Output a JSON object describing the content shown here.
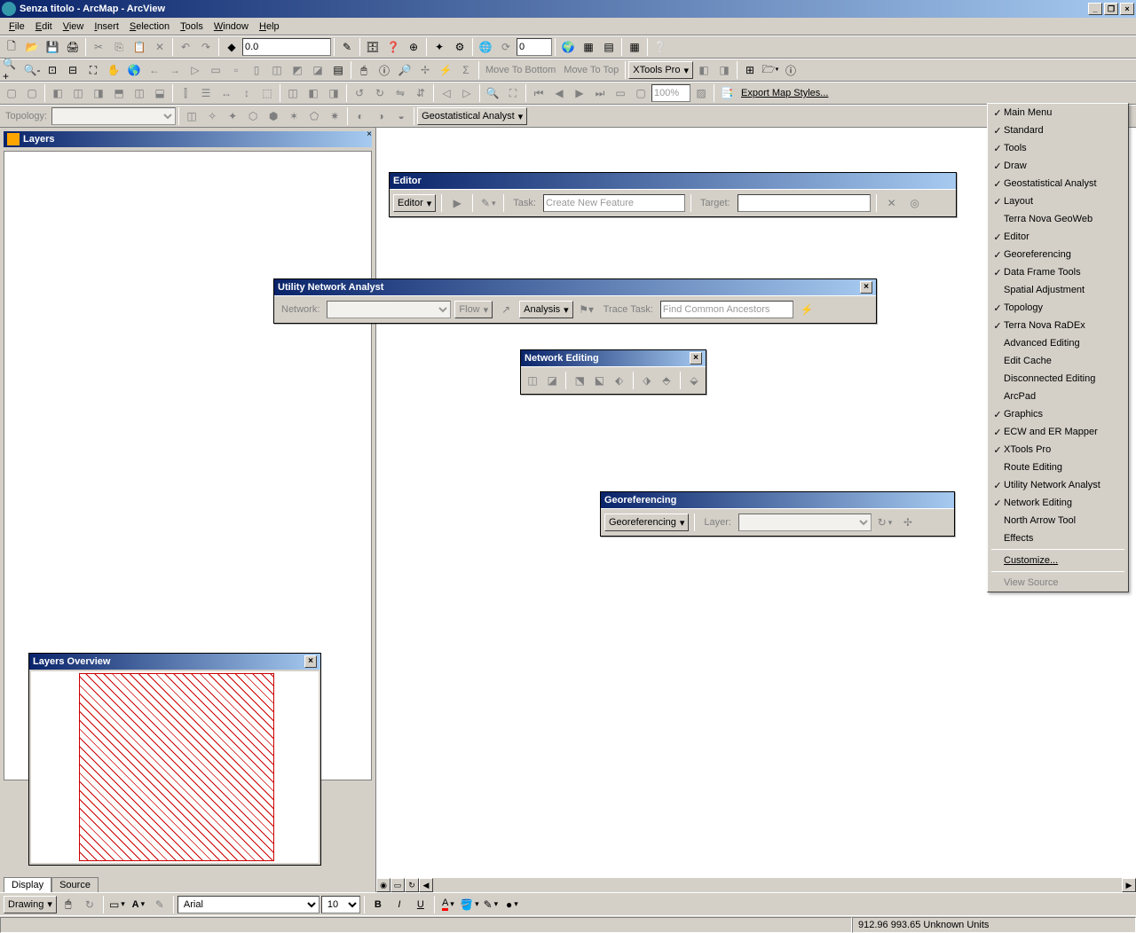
{
  "window": {
    "title": "Senza titolo - ArcMap - ArcView"
  },
  "menu": {
    "items": [
      "File",
      "Edit",
      "View",
      "Insert",
      "Selection",
      "Tools",
      "Window",
      "Help"
    ]
  },
  "toolbar1": {
    "scale_value": "0.0",
    "zoom_value": "0"
  },
  "toolbar2": {
    "move_bottom": "Move To Bottom",
    "move_top": "Move To Top",
    "xtools_label": "XTools Pro"
  },
  "toolbar3": {
    "percent": "100%",
    "export_label": "Export Map Styles..."
  },
  "topology_bar": {
    "label": "Topology:"
  },
  "geostat_bar": {
    "label": "Geostatistical Analyst"
  },
  "toc": {
    "title": "Layers"
  },
  "tabs": {
    "display": "Display",
    "source": "Source"
  },
  "editor_win": {
    "title": "Editor",
    "menu_label": "Editor",
    "task_label": "Task:",
    "task_value": "Create New Feature",
    "target_label": "Target:"
  },
  "utility_win": {
    "title": "Utility Network Analyst",
    "network_label": "Network:",
    "flow_label": "Flow",
    "analysis_label": "Analysis",
    "trace_label": "Trace Task:",
    "trace_value": "Find Common Ancestors"
  },
  "netedit_win": {
    "title": "Network Editing"
  },
  "georef_win": {
    "title": "Georeferencing",
    "menu_label": "Georeferencing",
    "layer_label": "Layer:"
  },
  "overview_win": {
    "title": "Layers Overview"
  },
  "context_menu": {
    "items": [
      {
        "label": "Main Menu",
        "checked": true
      },
      {
        "label": "Standard",
        "checked": true
      },
      {
        "label": "Tools",
        "checked": true
      },
      {
        "label": "Draw",
        "checked": true
      },
      {
        "label": "Geostatistical Analyst",
        "checked": true
      },
      {
        "label": "Layout",
        "checked": true
      },
      {
        "label": "Terra Nova GeoWeb",
        "checked": false
      },
      {
        "label": "Editor",
        "checked": true
      },
      {
        "label": "Georeferencing",
        "checked": true
      },
      {
        "label": "Data Frame Tools",
        "checked": true
      },
      {
        "label": "Spatial Adjustment",
        "checked": false
      },
      {
        "label": "Topology",
        "checked": true
      },
      {
        "label": "Terra Nova RaDEx",
        "checked": true
      },
      {
        "label": "Advanced Editing",
        "checked": false
      },
      {
        "label": "Edit Cache",
        "checked": false
      },
      {
        "label": "Disconnected Editing",
        "checked": false
      },
      {
        "label": "ArcPad",
        "checked": false
      },
      {
        "label": "Graphics",
        "checked": true
      },
      {
        "label": "ECW and ER Mapper",
        "checked": true
      },
      {
        "label": "XTools Pro",
        "checked": true
      },
      {
        "label": "Route Editing",
        "checked": false
      },
      {
        "label": "Utility Network Analyst",
        "checked": true
      },
      {
        "label": "Network Editing",
        "checked": true
      },
      {
        "label": "North Arrow Tool",
        "checked": false
      },
      {
        "label": "Effects",
        "checked": false
      }
    ],
    "customize": "Customize...",
    "view_source": "View Source"
  },
  "drawing": {
    "label": "Drawing",
    "font": "Arial",
    "size": "10"
  },
  "status": {
    "coords": "912.96 993.65 Unknown Units"
  }
}
